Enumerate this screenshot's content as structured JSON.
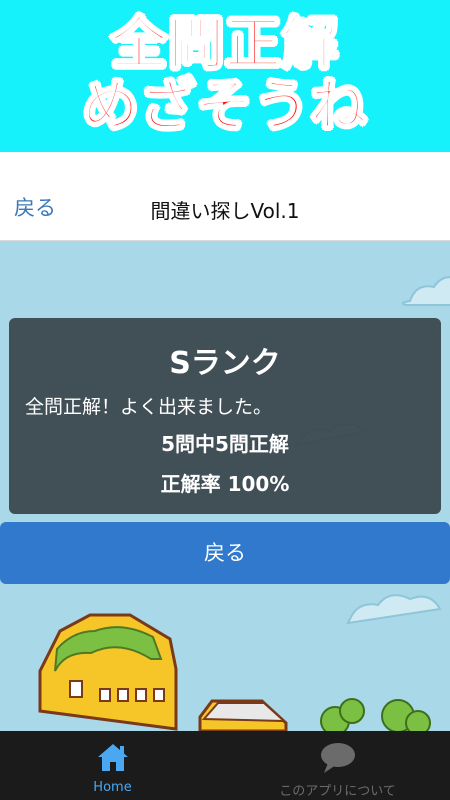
{
  "banner": {
    "line1": "全問正解",
    "line2": "めざそうね"
  },
  "navbar": {
    "back_label": "戻る",
    "title": "間違い探しVol.1"
  },
  "result": {
    "rank": "Sランク",
    "message": "全問正解！よく出来ました。",
    "score": "5問中5問正解",
    "rate": "正解率 100%"
  },
  "back_button": {
    "label": "戻る"
  },
  "tabbar": {
    "tabs": [
      {
        "label": "Home",
        "icon": "home-icon",
        "active": true
      },
      {
        "label": "このアプリについて",
        "icon": "speech-bubble-icon",
        "active": false
      }
    ]
  },
  "colors": {
    "banner_bg": "#16f2fb",
    "banner_text": "#ff1515",
    "sky": "#a9d8e8",
    "button_blue": "#3079cc",
    "active_tab": "#4aa7f0"
  }
}
